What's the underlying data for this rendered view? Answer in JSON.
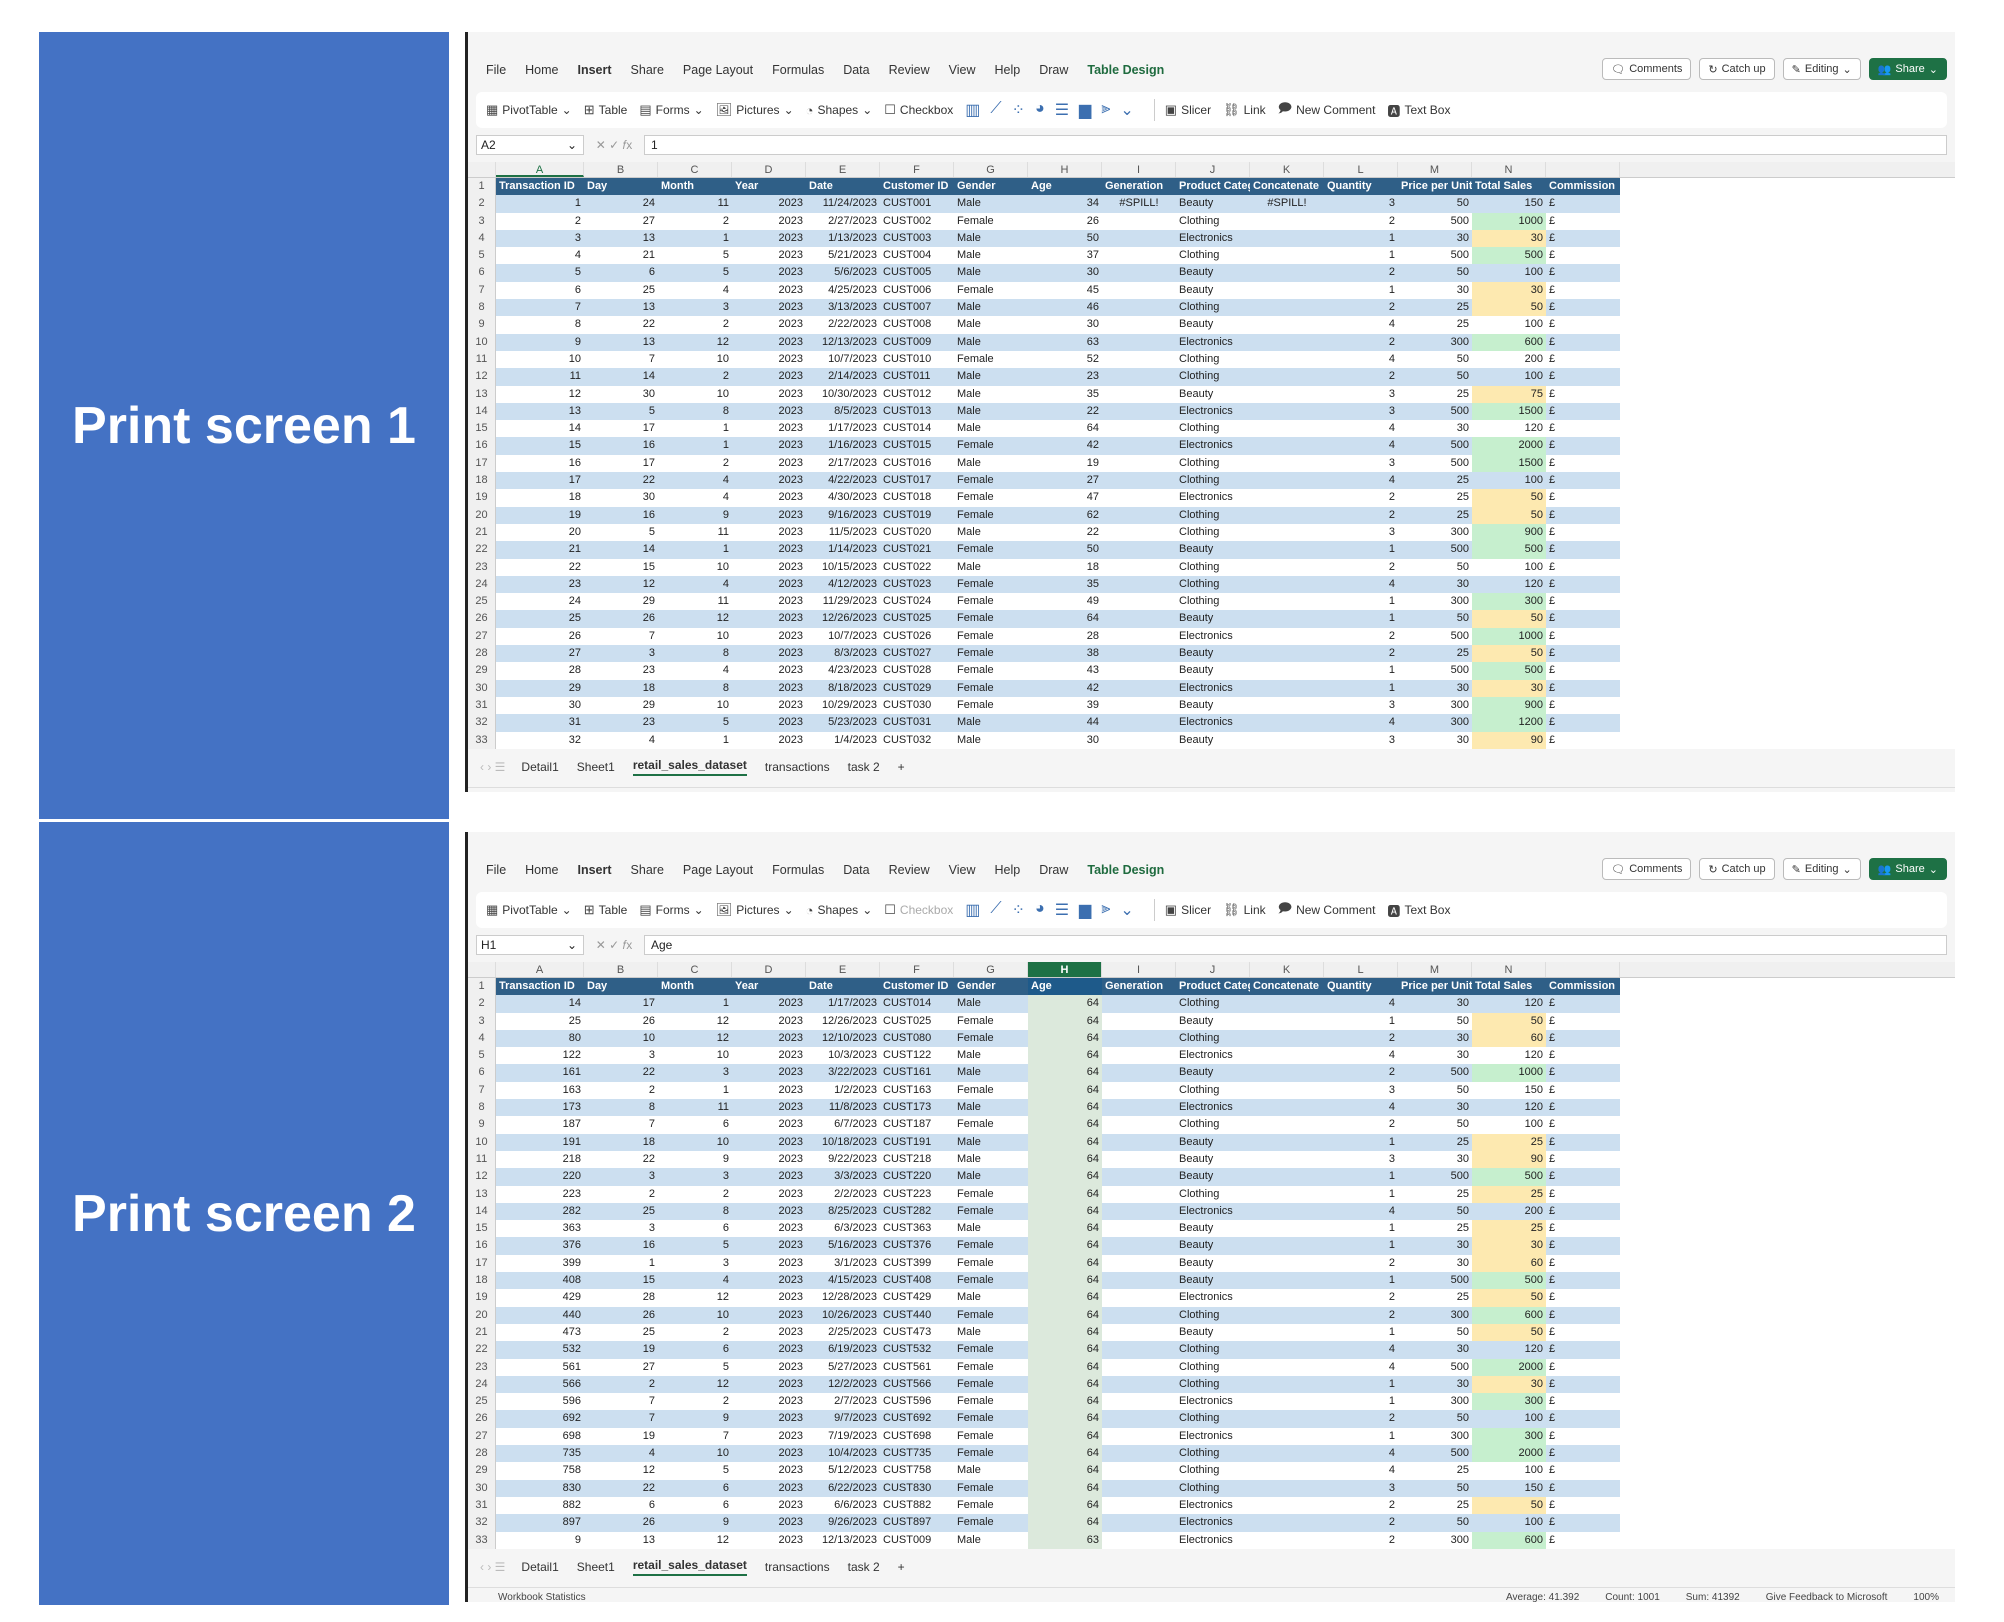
{
  "labels": [
    "Print screen 1",
    "Print screen 2"
  ],
  "menu": [
    "File",
    "Home",
    "Insert",
    "Share",
    "Page Layout",
    "Formulas",
    "Data",
    "Review",
    "View",
    "Help",
    "Draw",
    "Table Design"
  ],
  "topright": {
    "comments": "Comments",
    "catchup": "Catch up",
    "editing": "Editing",
    "share": "Share"
  },
  "ribbon": {
    "pivot": "PivotTable",
    "table": "Table",
    "forms": "Forms",
    "pictures": "Pictures",
    "shapes": "Shapes",
    "checkbox": "Checkbox",
    "slicer": "Slicer",
    "link": "Link",
    "newcomment": "New Comment",
    "textbox": "Text Box"
  },
  "columns": [
    "A",
    "B",
    "C",
    "D",
    "E",
    "F",
    "G",
    "H",
    "I",
    "J",
    "K",
    "L",
    "M",
    "N",
    ""
  ],
  "headers": [
    "Transaction ID",
    "Day",
    "Month",
    "Year",
    "Date",
    "Customer ID",
    "Gender",
    "Age",
    "Generation",
    "Product Category",
    "Concatenate",
    "Quantity",
    "Price per Unit",
    "Total Sales",
    "Commission"
  ],
  "tabs": [
    "Detail1",
    "Sheet1",
    "retail_sales_dataset",
    "transactions",
    "task 2"
  ],
  "status": {
    "workbook": "Workbook Statistics",
    "feedback": "Give Feedback to Microsoft",
    "zoom": "100%",
    "average": "Average: 41.392",
    "count": "Count: 1001",
    "sum": "Sum: 41392"
  },
  "screens": [
    {
      "namebox": "A2",
      "formula": "1",
      "rows": [
        [
          1,
          24,
          11,
          2023,
          "11/24/2023",
          "CUST001",
          "Male",
          34,
          "#SPILL!",
          "Beauty",
          "#SPILL!",
          3,
          50,
          150
        ],
        [
          2,
          27,
          2,
          2023,
          "2/27/2023",
          "CUST002",
          "Female",
          26,
          "",
          "Clothing",
          "",
          2,
          500,
          1000
        ],
        [
          3,
          13,
          1,
          2023,
          "1/13/2023",
          "CUST003",
          "Male",
          50,
          "",
          "Electronics",
          "",
          1,
          30,
          30
        ],
        [
          4,
          21,
          5,
          2023,
          "5/21/2023",
          "CUST004",
          "Male",
          37,
          "",
          "Clothing",
          "",
          1,
          500,
          500
        ],
        [
          5,
          6,
          5,
          2023,
          "5/6/2023",
          "CUST005",
          "Male",
          30,
          "",
          "Beauty",
          "",
          2,
          50,
          100
        ],
        [
          6,
          25,
          4,
          2023,
          "4/25/2023",
          "CUST006",
          "Female",
          45,
          "",
          "Beauty",
          "",
          1,
          30,
          30
        ],
        [
          7,
          13,
          3,
          2023,
          "3/13/2023",
          "CUST007",
          "Male",
          46,
          "",
          "Clothing",
          "",
          2,
          25,
          50
        ],
        [
          8,
          22,
          2,
          2023,
          "2/22/2023",
          "CUST008",
          "Male",
          30,
          "",
          "Beauty",
          "",
          4,
          25,
          100
        ],
        [
          9,
          13,
          12,
          2023,
          "12/13/2023",
          "CUST009",
          "Male",
          63,
          "",
          "Electronics",
          "",
          2,
          300,
          600
        ],
        [
          10,
          7,
          10,
          2023,
          "10/7/2023",
          "CUST010",
          "Female",
          52,
          "",
          "Clothing",
          "",
          4,
          50,
          200
        ],
        [
          11,
          14,
          2,
          2023,
          "2/14/2023",
          "CUST011",
          "Male",
          23,
          "",
          "Clothing",
          "",
          2,
          50,
          100
        ],
        [
          12,
          30,
          10,
          2023,
          "10/30/2023",
          "CUST012",
          "Male",
          35,
          "",
          "Beauty",
          "",
          3,
          25,
          75
        ],
        [
          13,
          5,
          8,
          2023,
          "8/5/2023",
          "CUST013",
          "Male",
          22,
          "",
          "Electronics",
          "",
          3,
          500,
          1500
        ],
        [
          14,
          17,
          1,
          2023,
          "1/17/2023",
          "CUST014",
          "Male",
          64,
          "",
          "Clothing",
          "",
          4,
          30,
          120
        ],
        [
          15,
          16,
          1,
          2023,
          "1/16/2023",
          "CUST015",
          "Female",
          42,
          "",
          "Electronics",
          "",
          4,
          500,
          2000
        ],
        [
          16,
          17,
          2,
          2023,
          "2/17/2023",
          "CUST016",
          "Male",
          19,
          "",
          "Clothing",
          "",
          3,
          500,
          1500
        ],
        [
          17,
          22,
          4,
          2023,
          "4/22/2023",
          "CUST017",
          "Female",
          27,
          "",
          "Clothing",
          "",
          4,
          25,
          100
        ],
        [
          18,
          30,
          4,
          2023,
          "4/30/2023",
          "CUST018",
          "Female",
          47,
          "",
          "Electronics",
          "",
          2,
          25,
          50
        ],
        [
          19,
          16,
          9,
          2023,
          "9/16/2023",
          "CUST019",
          "Female",
          62,
          "",
          "Clothing",
          "",
          2,
          25,
          50
        ],
        [
          20,
          5,
          11,
          2023,
          "11/5/2023",
          "CUST020",
          "Male",
          22,
          "",
          "Clothing",
          "",
          3,
          300,
          900
        ],
        [
          21,
          14,
          1,
          2023,
          "1/14/2023",
          "CUST021",
          "Female",
          50,
          "",
          "Beauty",
          "",
          1,
          500,
          500
        ],
        [
          22,
          15,
          10,
          2023,
          "10/15/2023",
          "CUST022",
          "Male",
          18,
          "",
          "Clothing",
          "",
          2,
          50,
          100
        ],
        [
          23,
          12,
          4,
          2023,
          "4/12/2023",
          "CUST023",
          "Female",
          35,
          "",
          "Clothing",
          "",
          4,
          30,
          120
        ],
        [
          24,
          29,
          11,
          2023,
          "11/29/2023",
          "CUST024",
          "Female",
          49,
          "",
          "Clothing",
          "",
          1,
          300,
          300
        ],
        [
          25,
          26,
          12,
          2023,
          "12/26/2023",
          "CUST025",
          "Female",
          64,
          "",
          "Beauty",
          "",
          1,
          50,
          50
        ],
        [
          26,
          7,
          10,
          2023,
          "10/7/2023",
          "CUST026",
          "Female",
          28,
          "",
          "Electronics",
          "",
          2,
          500,
          1000
        ],
        [
          27,
          3,
          8,
          2023,
          "8/3/2023",
          "CUST027",
          "Female",
          38,
          "",
          "Beauty",
          "",
          2,
          25,
          50
        ],
        [
          28,
          23,
          4,
          2023,
          "4/23/2023",
          "CUST028",
          "Female",
          43,
          "",
          "Beauty",
          "",
          1,
          500,
          500
        ],
        [
          29,
          18,
          8,
          2023,
          "8/18/2023",
          "CUST029",
          "Female",
          42,
          "",
          "Electronics",
          "",
          1,
          30,
          30
        ],
        [
          30,
          29,
          10,
          2023,
          "10/29/2023",
          "CUST030",
          "Female",
          39,
          "",
          "Beauty",
          "",
          3,
          300,
          900
        ],
        [
          31,
          23,
          5,
          2023,
          "5/23/2023",
          "CUST031",
          "Male",
          44,
          "",
          "Electronics",
          "",
          4,
          300,
          1200
        ],
        [
          32,
          4,
          1,
          2023,
          "1/4/2023",
          "CUST032",
          "Male",
          30,
          "",
          "Beauty",
          "",
          3,
          30,
          90
        ]
      ]
    },
    {
      "namebox": "H1",
      "formula": "Age",
      "rows": [
        [
          14,
          17,
          1,
          2023,
          "1/17/2023",
          "CUST014",
          "Male",
          64,
          "",
          "Clothing",
          "",
          4,
          30,
          120
        ],
        [
          25,
          26,
          12,
          2023,
          "12/26/2023",
          "CUST025",
          "Female",
          64,
          "",
          "Beauty",
          "",
          1,
          50,
          50
        ],
        [
          80,
          10,
          12,
          2023,
          "12/10/2023",
          "CUST080",
          "Female",
          64,
          "",
          "Clothing",
          "",
          2,
          30,
          60
        ],
        [
          122,
          3,
          10,
          2023,
          "10/3/2023",
          "CUST122",
          "Male",
          64,
          "",
          "Electronics",
          "",
          4,
          30,
          120
        ],
        [
          161,
          22,
          3,
          2023,
          "3/22/2023",
          "CUST161",
          "Male",
          64,
          "",
          "Beauty",
          "",
          2,
          500,
          1000
        ],
        [
          163,
          2,
          1,
          2023,
          "1/2/2023",
          "CUST163",
          "Female",
          64,
          "",
          "Clothing",
          "",
          3,
          50,
          150
        ],
        [
          173,
          8,
          11,
          2023,
          "11/8/2023",
          "CUST173",
          "Male",
          64,
          "",
          "Electronics",
          "",
          4,
          30,
          120
        ],
        [
          187,
          7,
          6,
          2023,
          "6/7/2023",
          "CUST187",
          "Female",
          64,
          "",
          "Clothing",
          "",
          2,
          50,
          100
        ],
        [
          191,
          18,
          10,
          2023,
          "10/18/2023",
          "CUST191",
          "Male",
          64,
          "",
          "Beauty",
          "",
          1,
          25,
          25
        ],
        [
          218,
          22,
          9,
          2023,
          "9/22/2023",
          "CUST218",
          "Male",
          64,
          "",
          "Beauty",
          "",
          3,
          30,
          90
        ],
        [
          220,
          3,
          3,
          2023,
          "3/3/2023",
          "CUST220",
          "Male",
          64,
          "",
          "Beauty",
          "",
          1,
          500,
          500
        ],
        [
          223,
          2,
          2,
          2023,
          "2/2/2023",
          "CUST223",
          "Female",
          64,
          "",
          "Clothing",
          "",
          1,
          25,
          25
        ],
        [
          282,
          25,
          8,
          2023,
          "8/25/2023",
          "CUST282",
          "Female",
          64,
          "",
          "Electronics",
          "",
          4,
          50,
          200
        ],
        [
          363,
          3,
          6,
          2023,
          "6/3/2023",
          "CUST363",
          "Male",
          64,
          "",
          "Beauty",
          "",
          1,
          25,
          25
        ],
        [
          376,
          16,
          5,
          2023,
          "5/16/2023",
          "CUST376",
          "Female",
          64,
          "",
          "Beauty",
          "",
          1,
          30,
          30
        ],
        [
          399,
          1,
          3,
          2023,
          "3/1/2023",
          "CUST399",
          "Female",
          64,
          "",
          "Beauty",
          "",
          2,
          30,
          60
        ],
        [
          408,
          15,
          4,
          2023,
          "4/15/2023",
          "CUST408",
          "Female",
          64,
          "",
          "Beauty",
          "",
          1,
          500,
          500
        ],
        [
          429,
          28,
          12,
          2023,
          "12/28/2023",
          "CUST429",
          "Male",
          64,
          "",
          "Electronics",
          "",
          2,
          25,
          50
        ],
        [
          440,
          26,
          10,
          2023,
          "10/26/2023",
          "CUST440",
          "Female",
          64,
          "",
          "Clothing",
          "",
          2,
          300,
          600
        ],
        [
          473,
          25,
          2,
          2023,
          "2/25/2023",
          "CUST473",
          "Male",
          64,
          "",
          "Beauty",
          "",
          1,
          50,
          50
        ],
        [
          532,
          19,
          6,
          2023,
          "6/19/2023",
          "CUST532",
          "Female",
          64,
          "",
          "Clothing",
          "",
          4,
          30,
          120
        ],
        [
          561,
          27,
          5,
          2023,
          "5/27/2023",
          "CUST561",
          "Female",
          64,
          "",
          "Clothing",
          "",
          4,
          500,
          2000
        ],
        [
          566,
          2,
          12,
          2023,
          "12/2/2023",
          "CUST566",
          "Female",
          64,
          "",
          "Clothing",
          "",
          1,
          30,
          30
        ],
        [
          596,
          7,
          2,
          2023,
          "2/7/2023",
          "CUST596",
          "Female",
          64,
          "",
          "Electronics",
          "",
          1,
          300,
          300
        ],
        [
          692,
          7,
          9,
          2023,
          "9/7/2023",
          "CUST692",
          "Female",
          64,
          "",
          "Clothing",
          "",
          2,
          50,
          100
        ],
        [
          698,
          19,
          7,
          2023,
          "7/19/2023",
          "CUST698",
          "Female",
          64,
          "",
          "Electronics",
          "",
          1,
          300,
          300
        ],
        [
          735,
          4,
          10,
          2023,
          "10/4/2023",
          "CUST735",
          "Female",
          64,
          "",
          "Clothing",
          "",
          4,
          500,
          2000
        ],
        [
          758,
          12,
          5,
          2023,
          "5/12/2023",
          "CUST758",
          "Male",
          64,
          "",
          "Clothing",
          "",
          4,
          25,
          100
        ],
        [
          830,
          22,
          6,
          2023,
          "6/22/2023",
          "CUST830",
          "Female",
          64,
          "",
          "Clothing",
          "",
          3,
          50,
          150
        ],
        [
          882,
          6,
          6,
          2023,
          "6/6/2023",
          "CUST882",
          "Female",
          64,
          "",
          "Electronics",
          "",
          2,
          25,
          50
        ],
        [
          897,
          26,
          9,
          2023,
          "9/26/2023",
          "CUST897",
          "Female",
          64,
          "",
          "Electronics",
          "",
          2,
          50,
          100
        ],
        [
          9,
          13,
          12,
          2023,
          "12/13/2023",
          "CUST009",
          "Male",
          63,
          "",
          "Electronics",
          "",
          2,
          300,
          600
        ]
      ]
    }
  ]
}
